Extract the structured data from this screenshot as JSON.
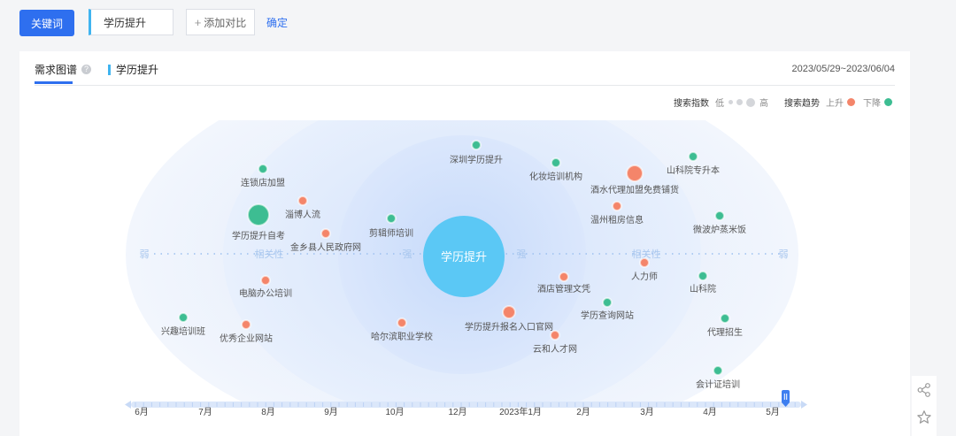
{
  "toolbar": {
    "keyword_button": "关键词",
    "keyword_value": "学历提升",
    "add_compare": "添加对比",
    "add_icon": "plus-icon",
    "confirm": "确定"
  },
  "card": {
    "tab_main": "需求图谱",
    "tab_keyword": "学历提升",
    "date_range": "2023/05/29~2023/06/04"
  },
  "legend": {
    "search_index_label": "搜索指数",
    "low": "低",
    "high": "高",
    "trend_label": "搜索趋势",
    "up": "上升",
    "down": "下降",
    "colors": {
      "up": "#f4856a",
      "down": "#3dbd92"
    }
  },
  "graph": {
    "center": "学历提升",
    "axis_labels": {
      "weak": "弱",
      "strong": "强",
      "relevance": "相关性"
    },
    "nodes": [
      {
        "label": "深圳学历提升",
        "trend": "down"
      },
      {
        "label": "化妆培训机构",
        "trend": "down"
      },
      {
        "label": "山科院专升本",
        "trend": "down"
      },
      {
        "label": "连锁店加盟",
        "trend": "down"
      },
      {
        "label": "酒水代理加盟免费铺货",
        "trend": "up"
      },
      {
        "label": "淄博人流",
        "trend": "up"
      },
      {
        "label": "温州租房信息",
        "trend": "up"
      },
      {
        "label": "学历提升自考",
        "trend": "down"
      },
      {
        "label": "剪辑师培训",
        "trend": "down"
      },
      {
        "label": "微波炉蒸米饭",
        "trend": "down"
      },
      {
        "label": "金乡县人民政府网",
        "trend": "up"
      },
      {
        "label": "人力师",
        "trend": "up"
      },
      {
        "label": "电脑办公培训",
        "trend": "up"
      },
      {
        "label": "酒店管理文凭",
        "trend": "up"
      },
      {
        "label": "山科院",
        "trend": "down"
      },
      {
        "label": "学历查询网站",
        "trend": "down"
      },
      {
        "label": "学历提升报名入口官网",
        "trend": "up"
      },
      {
        "label": "兴趣培训班",
        "trend": "down"
      },
      {
        "label": "优秀企业网站",
        "trend": "up"
      },
      {
        "label": "哈尔滨职业学校",
        "trend": "up"
      },
      {
        "label": "代理招生",
        "trend": "down"
      },
      {
        "label": "云和人才网",
        "trend": "up"
      },
      {
        "label": "会计证培训",
        "trend": "down"
      }
    ]
  },
  "timeline": [
    "6月",
    "7月",
    "8月",
    "9月",
    "10月",
    "12月",
    "2023年1月",
    "2月",
    "3月",
    "4月",
    "5月"
  ],
  "side": {
    "share_icon": "share-icon",
    "favorite_icon": "star-icon"
  }
}
